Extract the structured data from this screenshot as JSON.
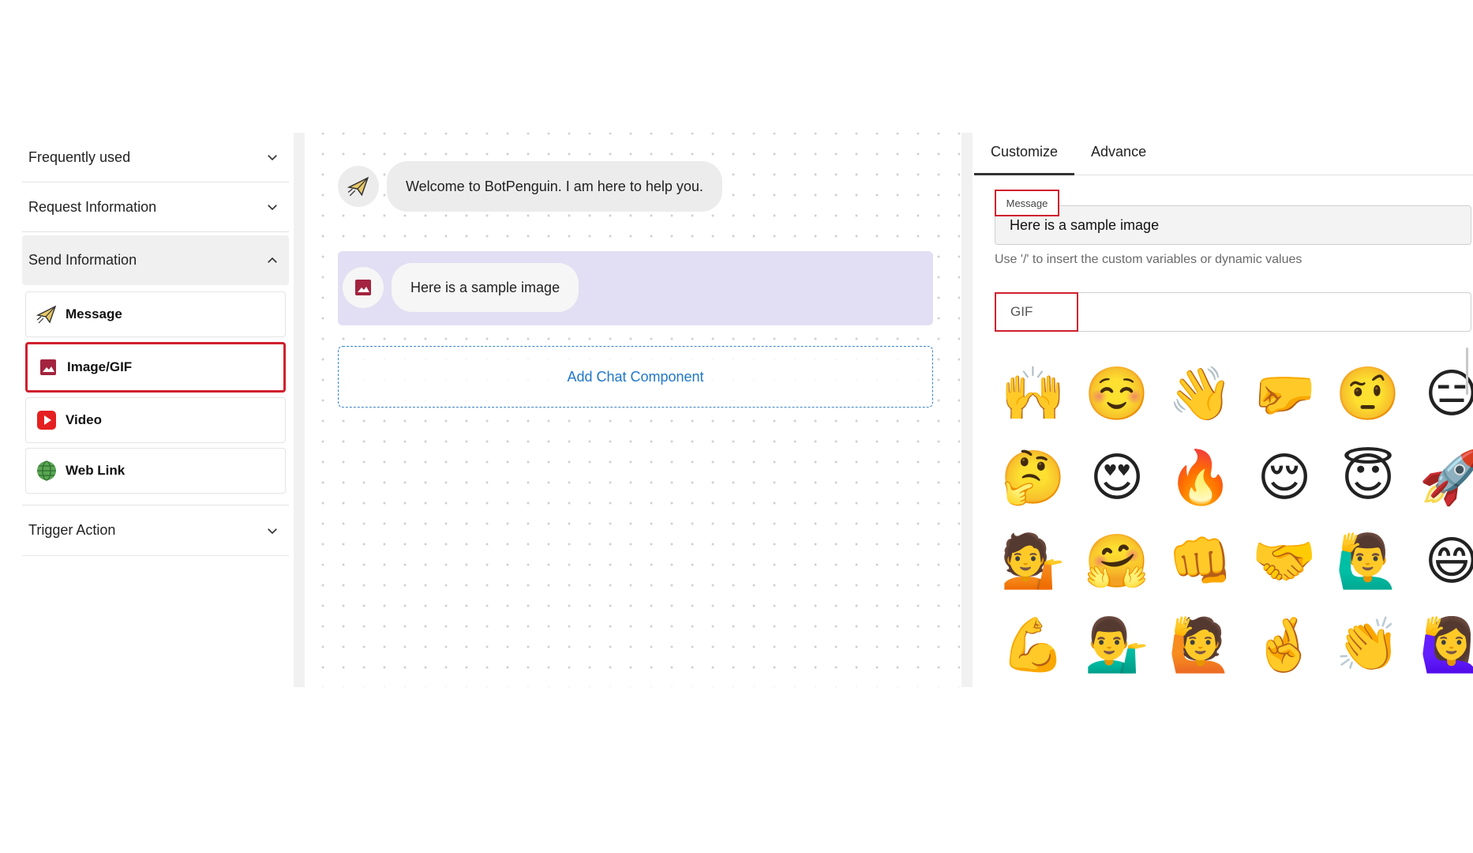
{
  "sidebar": {
    "sections": [
      {
        "label": "Frequently used",
        "open": false
      },
      {
        "label": "Request Information",
        "open": false
      },
      {
        "label": "Send Information",
        "open": true
      },
      {
        "label": "Trigger Action",
        "open": false
      }
    ],
    "send_items": [
      {
        "label": "Message",
        "icon": "paper-plane-icon"
      },
      {
        "label": "Image/GIF",
        "icon": "image-icon"
      },
      {
        "label": "Video",
        "icon": "youtube-play-icon"
      },
      {
        "label": "Web Link",
        "icon": "globe-icon"
      }
    ]
  },
  "canvas": {
    "welcome_message": "Welcome to BotPenguin. I am here to help you.",
    "image_message": "Here is a sample image",
    "add_component_label": "Add Chat Component"
  },
  "panel": {
    "tabs": [
      "Customize",
      "Advance"
    ],
    "message_label": "Message",
    "message_value": "Here is a sample image",
    "hint": "Use '/' to insert the custom variables or dynamic values",
    "gif_label": "GIF",
    "emojis": [
      "🙌",
      "☺️",
      "👋",
      "🤛",
      "🤨",
      "😑",
      "🤔",
      "😍",
      "🔥",
      "😌",
      "😇",
      "🚀",
      "💁",
      "🤗",
      "👊",
      "🤝",
      "🙋‍♂️",
      "😄",
      "💪",
      "💁‍♂️",
      "🙋",
      "🤞",
      "👏",
      "🙋‍♀️"
    ]
  },
  "colors": {
    "accent_red": "#d0202e",
    "link_blue": "#1f77c8",
    "selected_card": "#e2def3",
    "image_icon": "#a3243f",
    "video_icon": "#e52020"
  }
}
